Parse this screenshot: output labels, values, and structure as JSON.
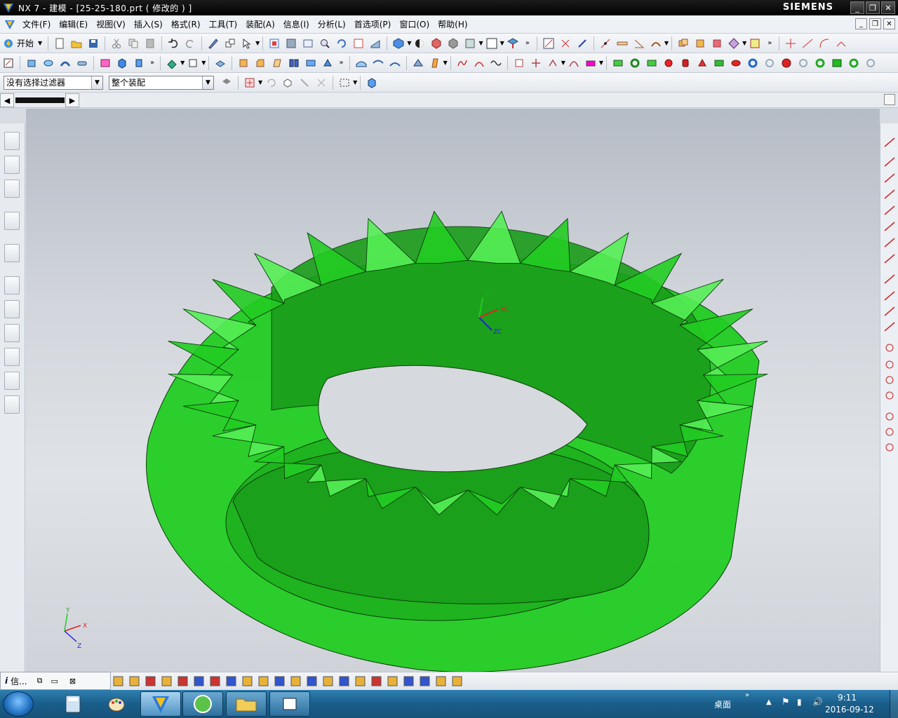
{
  "window": {
    "title": "NX 7 - 建模 - [25-25-180.prt  ( 修改的 ) ]",
    "brand": "SIEMENS",
    "controls": [
      "_",
      "❐",
      "✕"
    ]
  },
  "menu": {
    "items": [
      "文件(F)",
      "编辑(E)",
      "视图(V)",
      "插入(S)",
      "格式(R)",
      "工具(T)",
      "装配(A)",
      "信息(I)",
      "分析(L)",
      "首选项(P)",
      "窗口(O)",
      "帮助(H)"
    ],
    "mdi_controls": [
      "_",
      "❐",
      "✕"
    ]
  },
  "toolbar1": {
    "start_label": "开始"
  },
  "filter_bar": {
    "selection_filter": "没有选择过滤器",
    "assembly_scope": "整个装配"
  },
  "viewport": {
    "csys_labels": {
      "xc": "XC",
      "yc": "YC",
      "zc": "ZC"
    },
    "triad_labels": {
      "x": "X",
      "y": "Y",
      "z": "Z"
    }
  },
  "info_window": {
    "label": "信..."
  },
  "taskbar": {
    "desktop_label": "桌面",
    "time": "9:11",
    "date": "2016-09-12"
  },
  "colors": {
    "gear_fill": "#22cc22",
    "gear_dark": "#1a9d1a",
    "gear_light": "#55ee55",
    "edge": "#0d3d0d",
    "title_bar": "#000000",
    "taskbar": "#1a5e8a"
  }
}
